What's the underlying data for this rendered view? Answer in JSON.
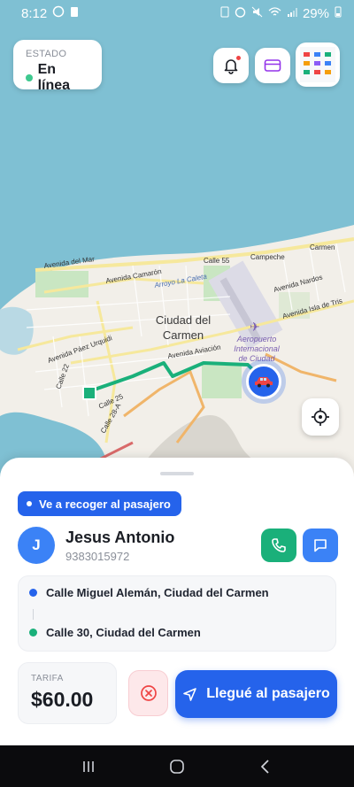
{
  "status_bar": {
    "time": "8:12",
    "battery": "29%"
  },
  "map": {
    "city_label_line1": "Ciudad del",
    "city_label_line2": "Carmen",
    "airport_label_line1": "Aeropuerto",
    "airport_label_line2": "Internacional",
    "airport_label_line3": "de Ciudad",
    "streets": {
      "campeche": "Campeche",
      "carmen": "Carmen",
      "calle55": "Calle 55",
      "av_camaron": "Avenida Camarón",
      "av_del_mar": "Avenida del Mar",
      "av_nardos": "Avenida Nardos",
      "av_isla_tris": "Avenida Isla de Tris",
      "av_paez": "Avenida Páez Urquidi",
      "av_aviacion": "Avenida Aviación",
      "arroyo": "Arroyo La Caleta",
      "calle22": "Calle 22",
      "calle25": "Calle 25",
      "calle28a": "Calle 28-A"
    },
    "colors": {
      "water": "#7fc0d3",
      "land": "#f2efe9",
      "route": "#1ab07a",
      "car": "#2563eb"
    }
  },
  "estado": {
    "label": "ESTADO",
    "value": "En línea"
  },
  "toolbar": {
    "notification_icon": "bell-icon",
    "payment_icon": "card-icon",
    "locate_icon": "crosshair-icon"
  },
  "trip": {
    "status_pill": "Ve a recoger al pasajero",
    "passenger": {
      "initial": "J",
      "name": "Jesus Antonio",
      "phone": "9383015972"
    },
    "pickup": "Calle Miguel Alemán, Ciudad del Carmen",
    "dropoff": "Calle 30, Ciudad del Carmen",
    "fare_label": "TARIFA",
    "fare_value": "$60.00",
    "arrive_button": "Llegué al pasajero"
  }
}
